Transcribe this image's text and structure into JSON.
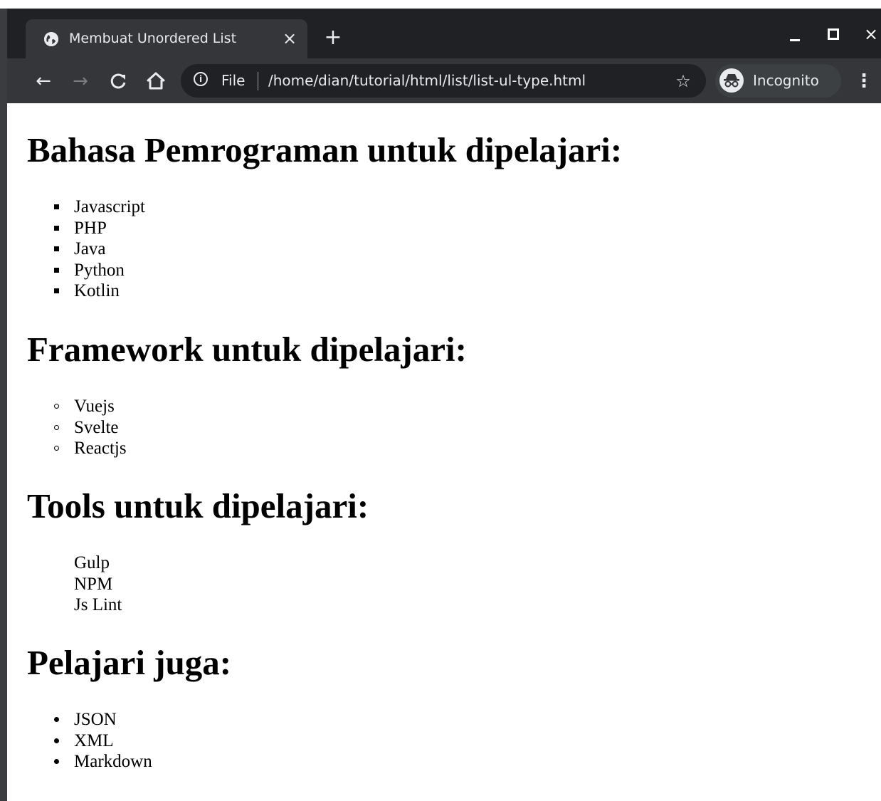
{
  "browser": {
    "tab_title": "Membuat Unordered List",
    "tab_close": "×",
    "new_tab": "+",
    "window_controls": {
      "minimize_icon": "minimize-icon",
      "maximize_icon": "maximize-icon",
      "close": "×"
    },
    "toolbar": {
      "back": "←",
      "forward": "→",
      "reload": "C",
      "home": "⌂",
      "info": "i",
      "scheme_label": "File",
      "url": "/home/dian/tutorial/html/list/list-ul-type.html",
      "star": "☆",
      "incognito_label": "Incognito",
      "menu": "⋮"
    }
  },
  "page": {
    "sections": [
      {
        "heading": "Bahasa Pemrograman untuk dipelajari:",
        "list_type": "square",
        "items": [
          "Javascript",
          "PHP",
          "Java",
          "Python",
          "Kotlin"
        ]
      },
      {
        "heading": "Framework untuk dipelajari:",
        "list_type": "circle",
        "items": [
          "Vuejs",
          "Svelte",
          "Reactjs"
        ]
      },
      {
        "heading": "Tools untuk dipelajari:",
        "list_type": "none",
        "items": [
          "Gulp",
          "NPM",
          "Js Lint"
        ]
      },
      {
        "heading": "Pelajari juga:",
        "list_type": "disc",
        "items": [
          "JSON",
          "XML",
          "Markdown"
        ]
      }
    ]
  }
}
